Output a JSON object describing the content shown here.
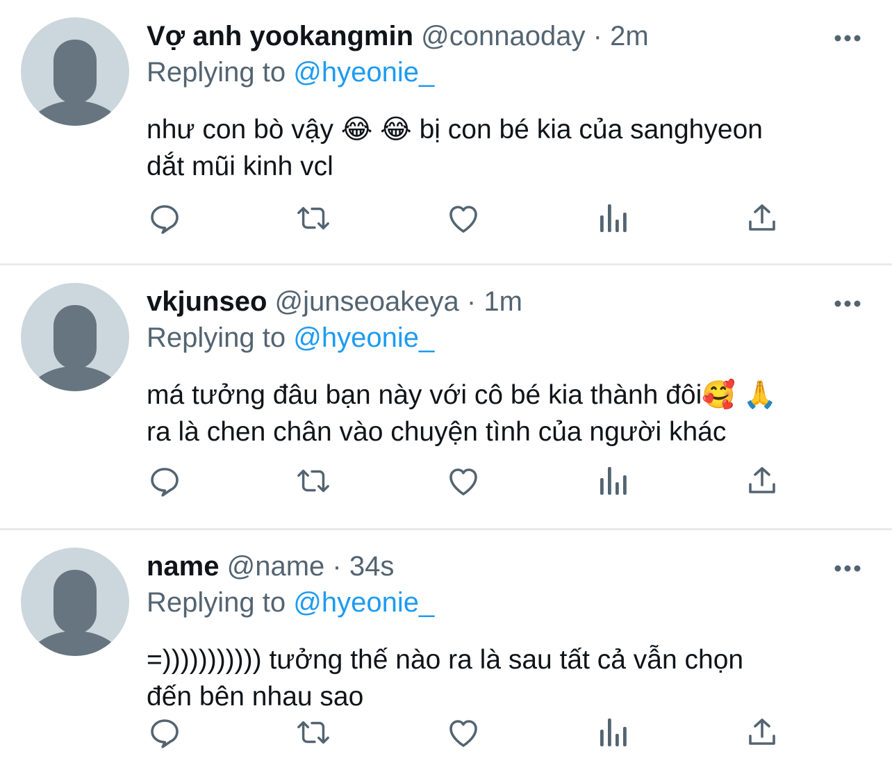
{
  "tweets": [
    {
      "display_name": "Vợ anh yookangmin",
      "handle": "@connaoday",
      "separator": "·",
      "time": "2m",
      "reply_prefix": "Replying to",
      "reply_to": "@hyeonie_",
      "text_line1": "như con bò vậy 😂 😂  bị con bé kia của sanghyeon",
      "text_line2": "dắt mũi kinh vcl"
    },
    {
      "display_name": "vkjunseo",
      "handle": "@junseoakeya",
      "separator": "·",
      "time": "1m",
      "reply_prefix": "Replying to",
      "reply_to": "@hyeonie_",
      "text_line1": "má tưởng đâu bạn này với cô bé kia thành đôi🥰 🙏",
      "text_line2": "ra là chen chân vào chuyện tình của người khác"
    },
    {
      "display_name": "name",
      "handle": "@name",
      "separator": "·",
      "time": "34s",
      "reply_prefix": "Replying to",
      "reply_to": "@hyeonie_",
      "text_line1": "=))))))))))) tưởng thế nào ra là sau tất cả vẫn chọn",
      "text_line2": "đến bên nhau sao"
    }
  ],
  "icons": {
    "avatar": "default-avatar-icon",
    "more": "more-horizontal-icon",
    "reply": "reply-icon",
    "retweet": "retweet-icon",
    "like": "heart-icon",
    "analytics": "analytics-icon",
    "share": "share-icon"
  },
  "colors": {
    "avatar_bg": "#ccd6dd",
    "avatar_fg": "#66757f",
    "secondary_text": "#536471",
    "mention": "#1d9bf0",
    "divider": "#e7e9ea"
  }
}
